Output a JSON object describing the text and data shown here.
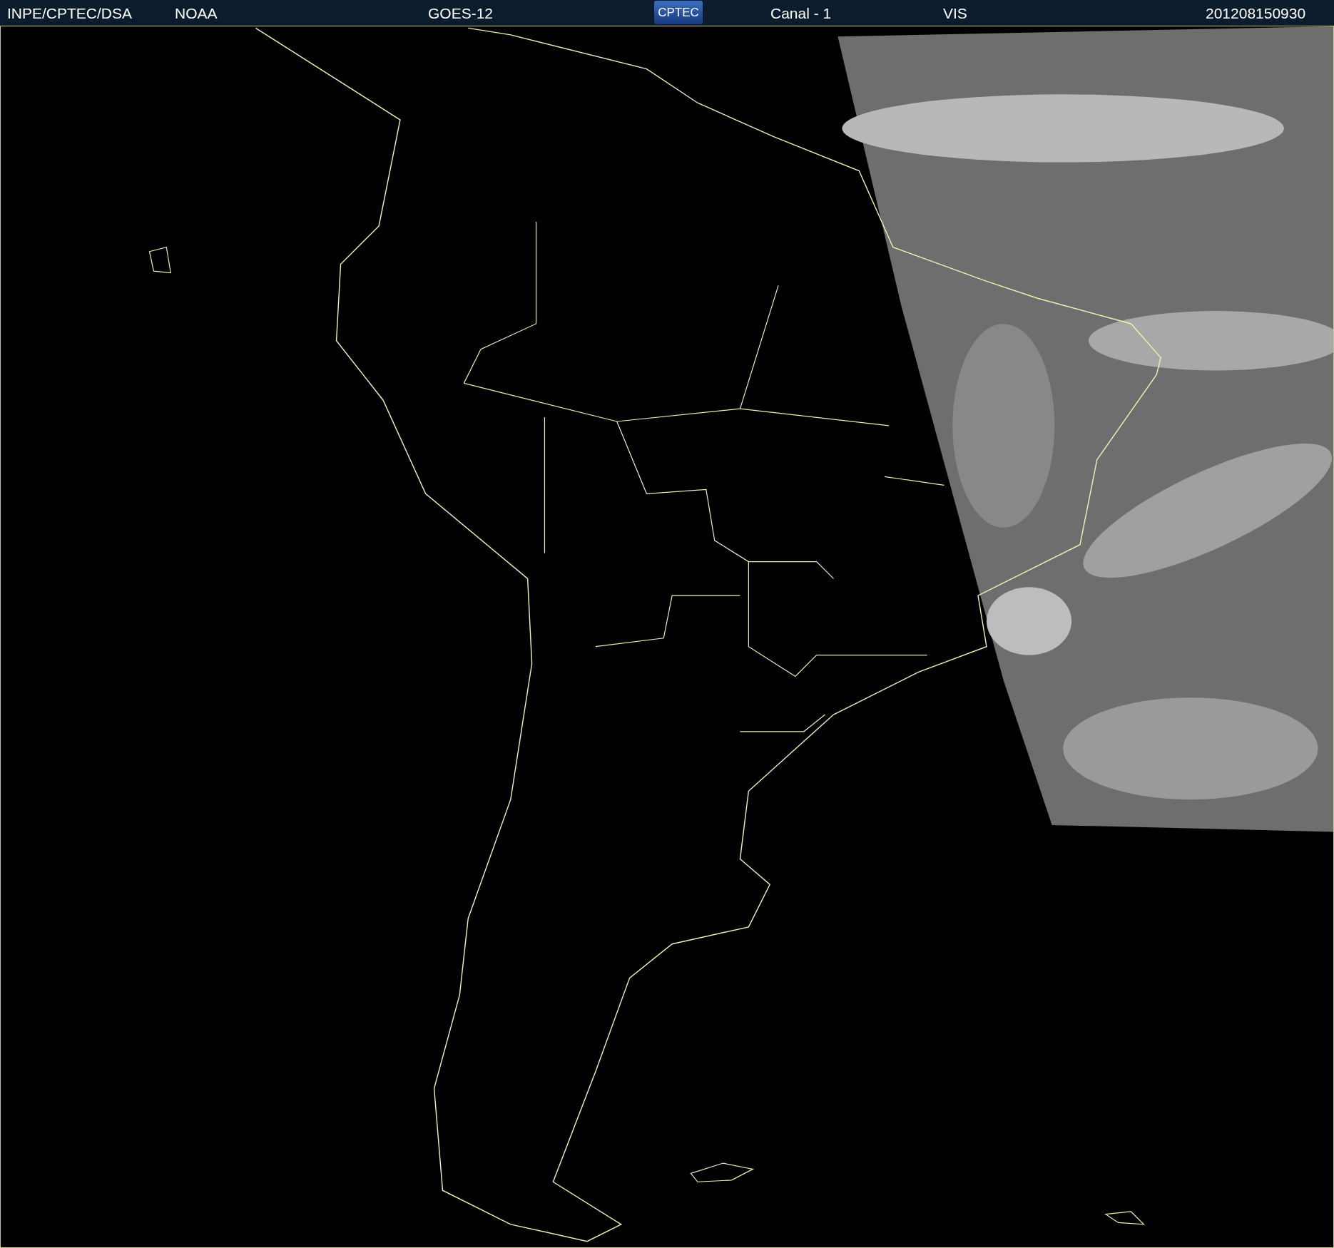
{
  "header": [
    {
      "kind": "label",
      "text": "INPE/CPTEC/DSA"
    },
    {
      "kind": "label",
      "text": "NOAA"
    },
    {
      "kind": "label",
      "text": "GOES-12"
    },
    {
      "kind": "logo",
      "text": "CPTEC"
    },
    {
      "kind": "label",
      "text": "Canal - 1"
    },
    {
      "kind": "label",
      "text": "VIS"
    },
    {
      "kind": "label",
      "text": "201208150930"
    }
  ]
}
